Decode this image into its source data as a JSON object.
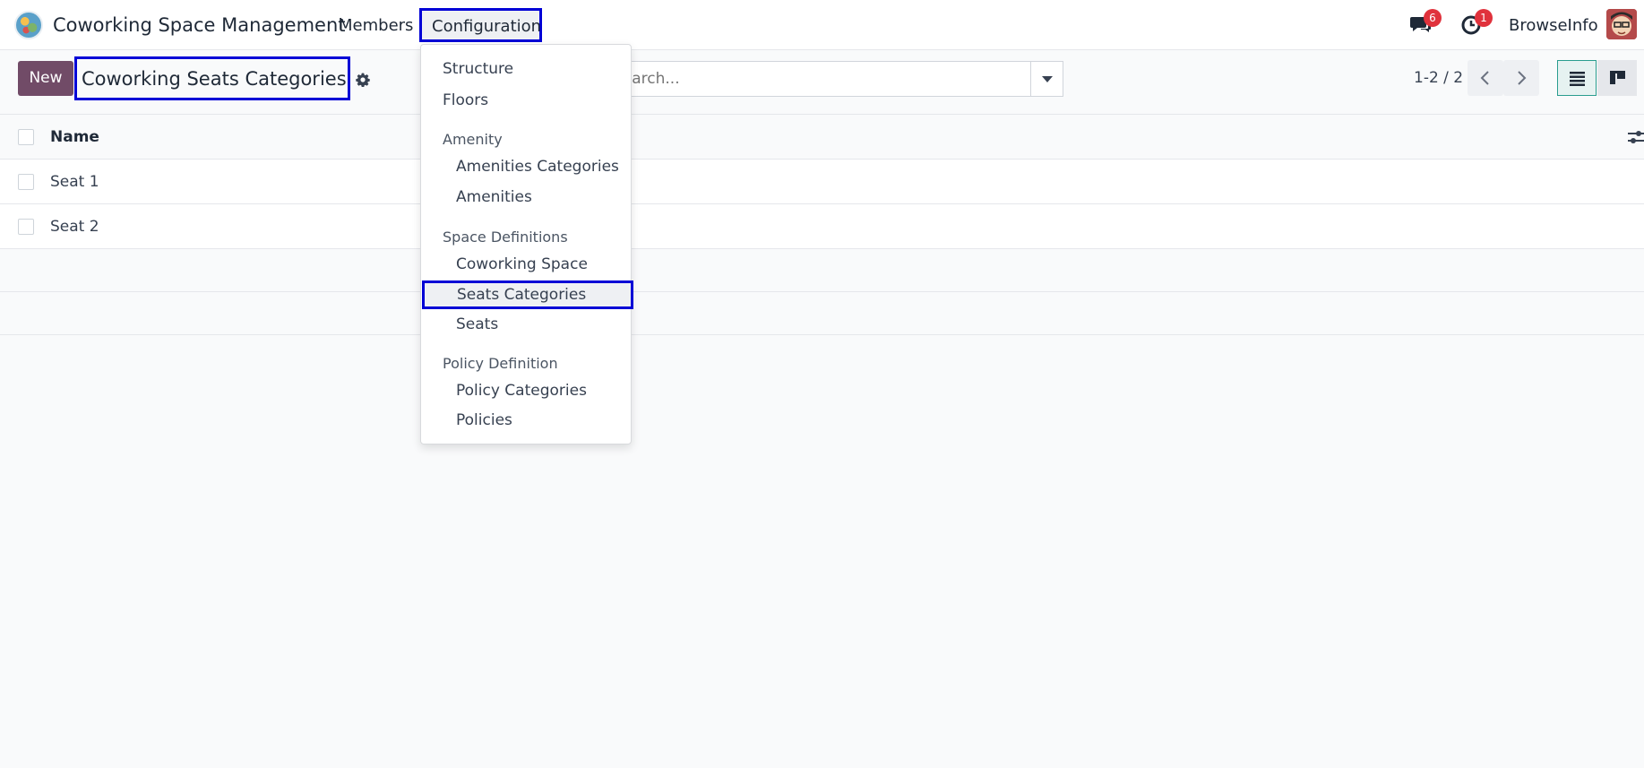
{
  "app": {
    "title": "Coworking Space Management"
  },
  "nav": {
    "members": "Members",
    "configuration": "Configuration"
  },
  "notifications": {
    "messages_count": "6",
    "activities_count": "1"
  },
  "user": {
    "name": "BrowseInfo"
  },
  "control": {
    "new_label": "New",
    "breadcrumb": "Coworking Seats Categories",
    "search_placeholder": "Search...",
    "pager": "1-2 / 2"
  },
  "list": {
    "column_name": "Name",
    "rows": [
      {
        "name": "Seat 1"
      },
      {
        "name": "Seat 2"
      }
    ]
  },
  "menu": {
    "structure": "Structure",
    "floors": "Floors",
    "amenity_section": "Amenity",
    "amenities_categories": "Amenities Categories",
    "amenities": "Amenities",
    "space_section": "Space Definitions",
    "coworking_space": "Coworking Space",
    "seats_categories": "Seats Categories",
    "seats": "Seats",
    "policy_section": "Policy Definition",
    "policy_categories": "Policy Categories",
    "policies": "Policies"
  },
  "colors": {
    "brand": "#714b67",
    "highlight_border": "#0000d6",
    "badge": "#e0323c"
  },
  "icons": [
    "app-logo",
    "chat-icon",
    "clock-icon",
    "gear-icon",
    "caret-down-icon",
    "chevron-left-icon",
    "chevron-right-icon",
    "list-view-icon",
    "kanban-view-icon",
    "optional-columns-icon"
  ]
}
